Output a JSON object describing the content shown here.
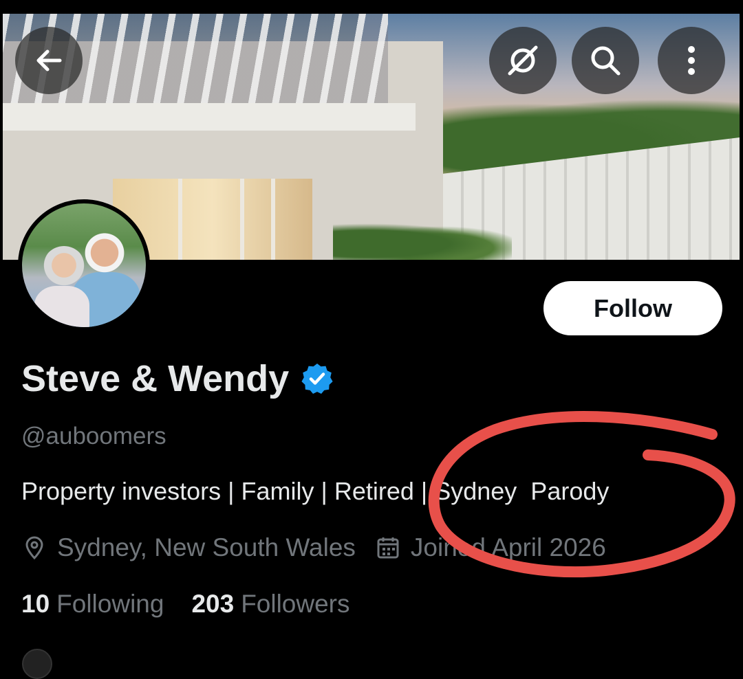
{
  "header": {
    "back_icon": "arrow-left-icon",
    "grok_icon": "grok-icon",
    "search_icon": "search-icon",
    "more_icon": "more-vertical-icon"
  },
  "profile": {
    "follow_label": "Follow",
    "name": "Steve & Wendy",
    "verified": true,
    "verified_color": "#1d9bf0",
    "handle": "@auboomers",
    "bio": "Property investors | Family | Retired | Sydney  Parody",
    "location": "Sydney, New South Wales",
    "joined": "Joined April 2026",
    "following_count": "10",
    "following_label": "Following",
    "followers_count": "203",
    "followers_label": "Followers"
  },
  "annotation": {
    "color": "#e8504a",
    "shape": "hand-drawn-circle"
  }
}
